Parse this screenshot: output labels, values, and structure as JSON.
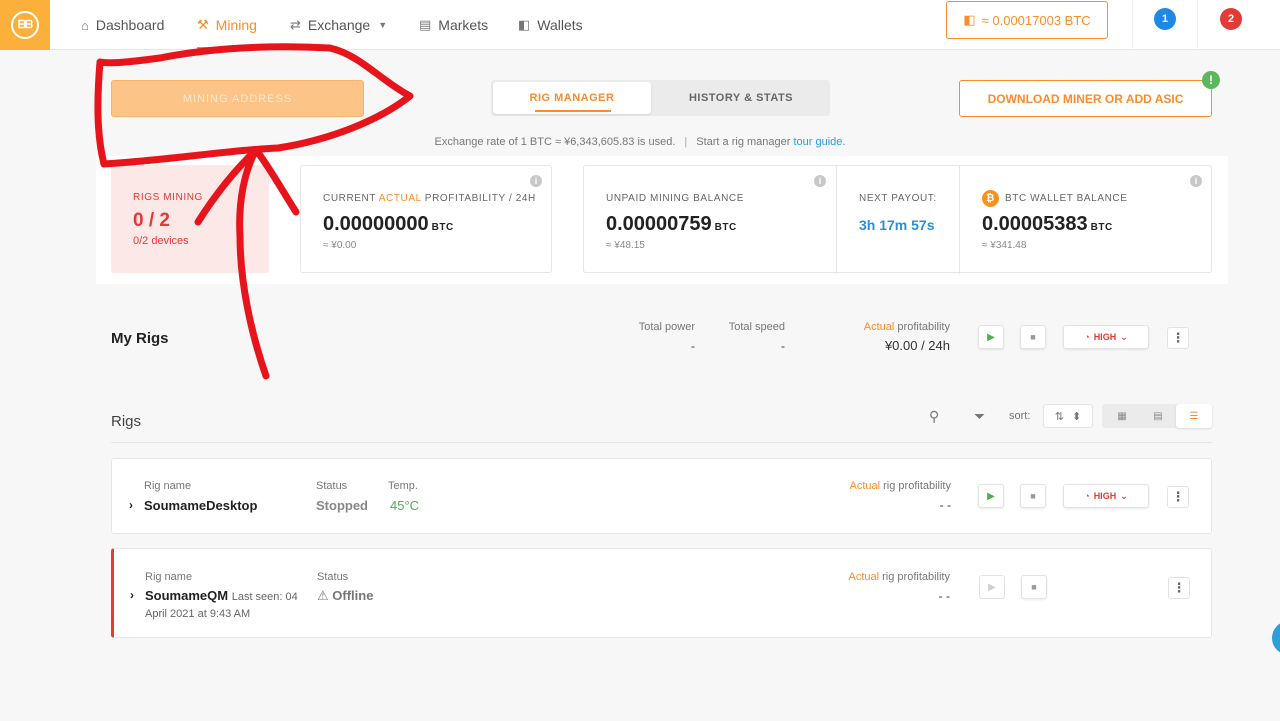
{
  "nav": {
    "items": [
      {
        "label": "Dashboard",
        "icon": "home-icon"
      },
      {
        "label": "Mining",
        "icon": "pickaxe-icon"
      },
      {
        "label": "Exchange",
        "icon": "exchange-icon"
      },
      {
        "label": "Markets",
        "icon": "coins-icon"
      },
      {
        "label": "Wallets",
        "icon": "wallet-icon"
      }
    ],
    "active_item": "Mining",
    "btc_balance": "≈ 0.00017003 BTC",
    "notifications_blue": "1",
    "notifications_red": "2"
  },
  "top": {
    "mining_address_label": "MINING ADDRESS",
    "tabs": [
      {
        "label": "RIG MANAGER"
      },
      {
        "label": "HISTORY & STATS"
      }
    ],
    "active_tab": "RIG MANAGER",
    "download_label": "DOWNLOAD MINER OR ADD ASIC",
    "rate_text": "Exchange rate of 1 BTC ≈ ¥6,343,605.83 is used.",
    "tour_prefix": "Start a rig manager ",
    "tour_link": "tour guide",
    "tour_suffix": "."
  },
  "stats": {
    "rigs_mining_label": "RIGS MINING",
    "rigs_mining_value": "0 / 2",
    "rigs_mining_sub": "0/2 devices",
    "profit_label_pre": "CURRENT ",
    "profit_label_highlight": "ACTUAL",
    "profit_label_post": " PROFITABILITY / 24H",
    "profit_value": "0.00000000",
    "profit_unit": "BTC",
    "profit_approx": "≈ ¥0.00",
    "unpaid_label": "UNPAID MINING BALANCE",
    "unpaid_value": "0.00000759",
    "unpaid_unit": "BTC",
    "unpaid_approx": "≈ ¥48.15",
    "payout_label": "NEXT PAYOUT:",
    "payout_value": "3h 17m 57s",
    "wallet_label": "BTC WALLET BALANCE",
    "wallet_value": "0.00005383",
    "wallet_unit": "BTC",
    "wallet_approx": "≈ ¥341.48"
  },
  "my_rigs": {
    "title": "My Rigs",
    "total_power_label": "Total power",
    "total_power_value": "-",
    "total_speed_label": "Total speed",
    "total_speed_value": "-",
    "profit_label_highlight": "Actual",
    "profit_label_rest": " profitability",
    "profit_value": "¥0.00 / 24h",
    "power_mode": "HIGH"
  },
  "rigs": {
    "title": "Rigs",
    "sort_label": "sort:",
    "list": [
      {
        "name_label": "Rig name",
        "name": "SoumameDesktop",
        "status_label": "Status",
        "status": "Stopped",
        "temp_label": "Temp.",
        "temp": "45°C",
        "profit_highlight": "Actual",
        "profit_rest": " rig profitability",
        "profit_value": "- -",
        "power_mode": "HIGH"
      },
      {
        "name_label": "Rig name",
        "name": "SoumameQM",
        "last_seen": "Last seen: 04",
        "last_seen_2": "April 2021 at 9:43 AM",
        "status_label": "Status",
        "status": "Offline",
        "profit_highlight": "Actual",
        "profit_rest": " rig profitability",
        "profit_value": "- -"
      }
    ]
  },
  "colors": {
    "accent": "#fb8c29",
    "danger": "#e53935",
    "link": "#2a9fd8",
    "success": "#4caf50",
    "annotation": "#e8141b"
  }
}
